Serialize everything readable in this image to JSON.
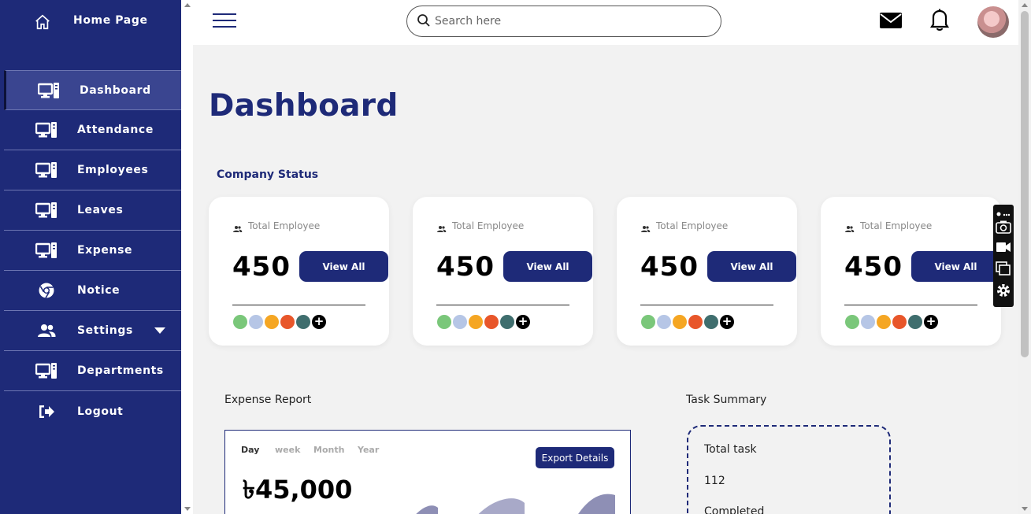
{
  "colors": {
    "brand": "#1e2a78",
    "sidebar_active": "#3a4590",
    "background": "#f2f2f2"
  },
  "sidebar": {
    "home": {
      "label": "Home Page",
      "icon": "home-icon"
    },
    "items": [
      {
        "label": "Dashboard",
        "icon": "computer-icon",
        "active": true
      },
      {
        "label": "Attendance",
        "icon": "computer-icon"
      },
      {
        "label": "Employees",
        "icon": "computer-icon"
      },
      {
        "label": "Leaves",
        "icon": "computer-icon"
      },
      {
        "label": "Expense",
        "icon": "computer-icon"
      },
      {
        "label": "Notice",
        "icon": "chrome-icon"
      },
      {
        "label": "Settings",
        "icon": "users-icon",
        "has_dropdown": true
      },
      {
        "label": "Departments",
        "icon": "computer-icon"
      },
      {
        "label": "Logout",
        "icon": "logout-icon"
      }
    ]
  },
  "header": {
    "search_placeholder": "Search here",
    "icons": [
      "menu-icon",
      "search-icon",
      "mail-icon",
      "bell-icon",
      "user-avatar"
    ]
  },
  "main": {
    "title": "Dashboard",
    "company_status_title": "Company Status",
    "cards": [
      {
        "label": "Total Employee",
        "value": "450",
        "button": "View All"
      },
      {
        "label": "Total Employee",
        "value": "450",
        "button": "View All"
      },
      {
        "label": "Total Employee",
        "value": "450",
        "button": "View All"
      },
      {
        "label": "Total Employee",
        "value": "450",
        "button": "View All"
      }
    ],
    "expense": {
      "title": "Expense Report",
      "tabs": [
        "Day",
        "week",
        "Month",
        "Year"
      ],
      "active_tab": "Day",
      "export_label": "Export Details",
      "amount": "৳45,000"
    },
    "tasks": {
      "title": "Task Summary",
      "lines": [
        "Total task",
        "112",
        "Completed"
      ]
    }
  }
}
